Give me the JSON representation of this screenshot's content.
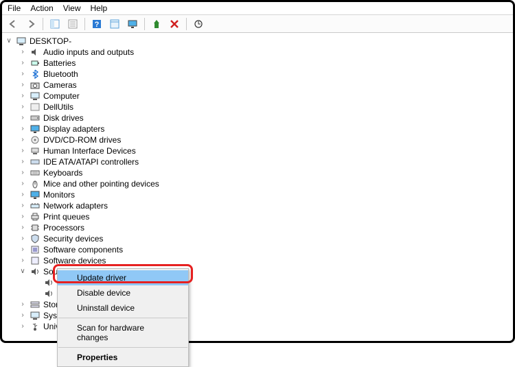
{
  "menubar": {
    "file": "File",
    "action": "Action",
    "view": "View",
    "help": "Help"
  },
  "tree": {
    "root": "DESKTOP-",
    "items": [
      "Audio inputs and outputs",
      "Batteries",
      "Bluetooth",
      "Cameras",
      "Computer",
      "DellUtils",
      "Disk drives",
      "Display adapters",
      "DVD/CD-ROM drives",
      "Human Interface Devices",
      "IDE ATA/ATAPI controllers",
      "Keyboards",
      "Mice and other pointing devices",
      "Monitors",
      "Network adapters",
      "Print queues",
      "Processors",
      "Security devices",
      "Software components",
      "Software devices",
      "Sound, video and game controllers"
    ],
    "sound_children": [
      "",
      ""
    ],
    "after_sound": [
      "Stor",
      "Syst",
      "Univ"
    ]
  },
  "ctx": {
    "update": "Update driver",
    "disable": "Disable device",
    "uninstall": "Uninstall device",
    "scan": "Scan for hardware changes",
    "properties": "Properties"
  },
  "colors": {
    "highlight": "#90c8f6",
    "redbox": "#e62020"
  }
}
